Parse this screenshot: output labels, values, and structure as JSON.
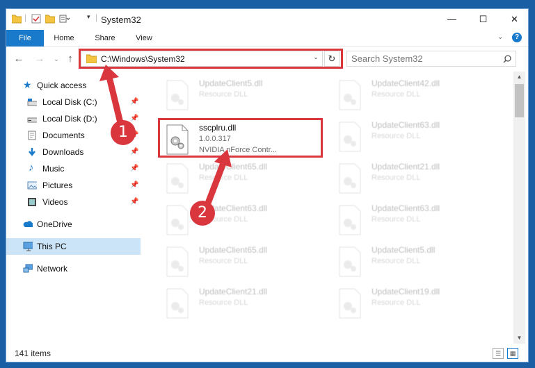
{
  "window": {
    "title": "System32",
    "minimize": "—",
    "maximize": "☐",
    "close": "✕"
  },
  "ribbon": {
    "tabs": [
      "File",
      "Home",
      "Share",
      "View"
    ]
  },
  "address": {
    "path": "C:\\Windows\\System32",
    "search_placeholder": "Search System32"
  },
  "sidebar": {
    "items": [
      {
        "label": "Quick access",
        "icon": "star-icon",
        "pinned": false
      },
      {
        "label": "Local Disk (C:)",
        "icon": "drive-icon",
        "pinned": true
      },
      {
        "label": "Local Disk (D:)",
        "icon": "drive-icon",
        "pinned": true
      },
      {
        "label": "Documents",
        "icon": "documents-icon",
        "pinned": true
      },
      {
        "label": "Downloads",
        "icon": "download-icon",
        "pinned": true
      },
      {
        "label": "Music",
        "icon": "music-icon",
        "pinned": true
      },
      {
        "label": "Pictures",
        "icon": "pictures-icon",
        "pinned": true
      },
      {
        "label": "Videos",
        "icon": "videos-icon",
        "pinned": true
      },
      {
        "label": "OneDrive",
        "icon": "cloud-icon",
        "pinned": false
      },
      {
        "label": "This PC",
        "icon": "computer-icon",
        "pinned": false
      },
      {
        "label": "Network",
        "icon": "network-icon",
        "pinned": false
      }
    ]
  },
  "files": {
    "highlighted": {
      "name": "sscplru.dll",
      "version": "1.0.0.317",
      "description": "NVIDIA nForce Contr..."
    },
    "left_column": [
      {
        "name": "UpdateClient5.dll",
        "type": "Resource DLL"
      },
      {
        "name": "UpdateClient65.dll",
        "type": "Resource DLL"
      },
      {
        "name": "UpdateClient63.dll",
        "type": "Resource DLL"
      },
      {
        "name": "UpdateClient65.dll",
        "type": "Resource DLL"
      },
      {
        "name": "UpdateClient21.dll",
        "type": "Resource DLL"
      }
    ],
    "right_column": [
      {
        "name": "UpdateClient42.dll",
        "type": "Resource DLL"
      },
      {
        "name": "UpdateClient63.dll",
        "type": "Resource DLL"
      },
      {
        "name": "UpdateClient21.dll",
        "type": "Resource DLL"
      },
      {
        "name": "UpdateClient63.dll",
        "type": "Resource DLL"
      },
      {
        "name": "UpdateClient5.dll",
        "type": "Resource DLL"
      },
      {
        "name": "UpdateClient19.dll",
        "type": "Resource DLL"
      }
    ]
  },
  "status": {
    "item_count": "141 items"
  },
  "markers": {
    "step1": "1",
    "step2": "2"
  },
  "colors": {
    "accent": "#1979ca",
    "highlight": "#d9363e",
    "selected_nav": "#cce4f7"
  }
}
